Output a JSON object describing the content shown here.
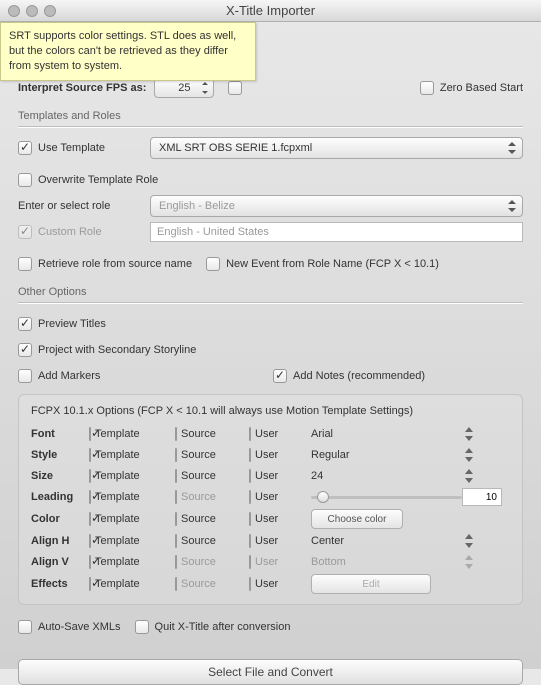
{
  "window": {
    "title": "X-Title Importer"
  },
  "tooltip": "SRT supports color settings. STL does as well, but the colors can't be retrieved as they differ from system to system.",
  "timing": {
    "interpret_label": "Interpret Source FPS as:",
    "fps": "25",
    "zero_based": "Zero Based Start"
  },
  "templates": {
    "section": "Templates and Roles",
    "use_template": "Use Template",
    "template_value": "XML SRT OBS SERIE 1.fcpxml",
    "overwrite": "Overwrite Template Role",
    "enter_role": "Enter or select role",
    "role_value": "English - Belize",
    "custom_role": "Custom Role",
    "custom_value": "English - United States",
    "retrieve": "Retrieve role from source name",
    "new_event": "New Event from Role Name (FCP X < 10.1)"
  },
  "other": {
    "section": "Other Options",
    "preview": "Preview Titles",
    "secondary": "Project with Secondary Storyline",
    "markers": "Add Markers",
    "notes": "Add Notes (recommended)",
    "fcpx_box": "FCPX 10.1.x Options (FCP X < 10.1 will always use Motion Template Settings)",
    "cols": {
      "template": "Template",
      "source": "Source",
      "user": "User"
    },
    "rows": {
      "font": {
        "label": "Font",
        "val": "Arial"
      },
      "style": {
        "label": "Style",
        "val": "Regular"
      },
      "size": {
        "label": "Size",
        "val": "24"
      },
      "leading": {
        "label": "Leading",
        "val": "10"
      },
      "color": {
        "label": "Color",
        "btn": "Choose color"
      },
      "alignh": {
        "label": "Align H",
        "val": "Center"
      },
      "alignv": {
        "label": "Align V",
        "val": "Bottom"
      },
      "effects": {
        "label": "Effects",
        "btn": "Edit"
      }
    }
  },
  "footer": {
    "autosave": "Auto-Save XMLs",
    "quit": "Quit X-Title after conversion",
    "action": "Select File and Convert"
  }
}
